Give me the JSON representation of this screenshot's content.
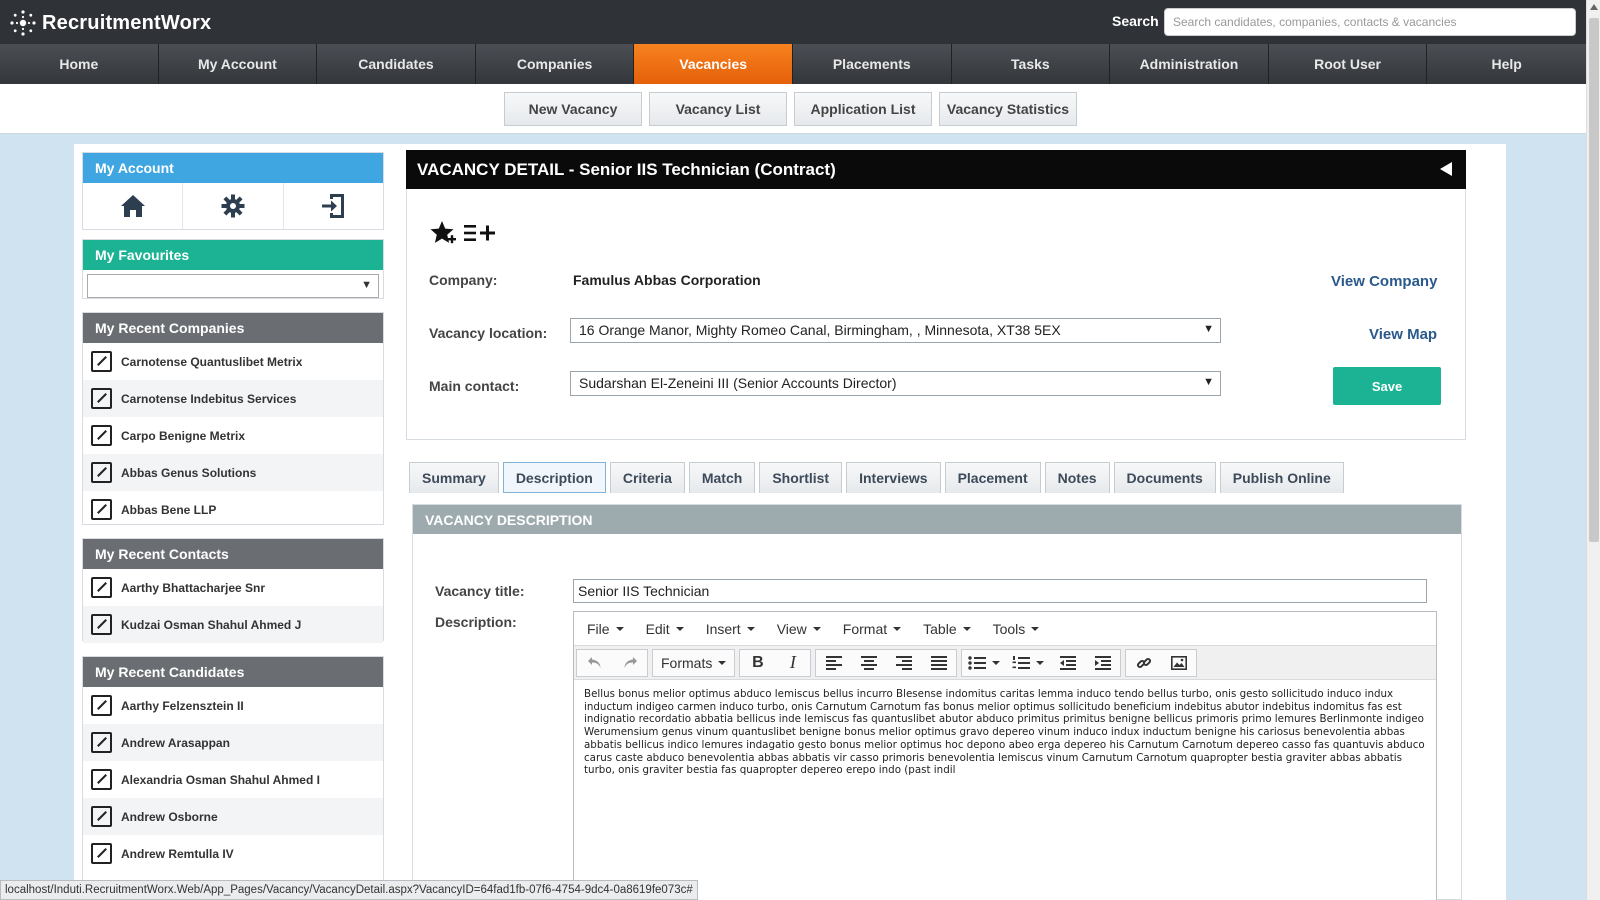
{
  "app": {
    "name": "RecruitmentWorx",
    "search_label": "Search",
    "search_placeholder": "Search candidates, companies, contacts & vacancies"
  },
  "nav": {
    "items": [
      "Home",
      "My Account",
      "Candidates",
      "Companies",
      "Vacancies",
      "Placements",
      "Tasks",
      "Administration",
      "Root User",
      "Help"
    ],
    "active": "Vacancies"
  },
  "subnav": {
    "items": [
      "New Vacancy",
      "Vacancy List",
      "Application List",
      "Vacancy Statistics"
    ]
  },
  "sidebar": {
    "my_account": "My Account",
    "my_favourites": "My Favourites",
    "recent_companies": {
      "title": "My Recent Companies",
      "items": [
        "Carnotense Quantuslibet Metrix",
        "Carnotense Indebitus Services",
        "Carpo Benigne Metrix",
        "Abbas Genus Solutions",
        "Abbas Bene LLP"
      ]
    },
    "recent_contacts": {
      "title": "My Recent Contacts",
      "items": [
        "Aarthy Bhattacharjee Snr",
        "Kudzai Osman Shahul Ahmed J"
      ]
    },
    "recent_candidates": {
      "title": "My Recent Candidates",
      "items": [
        "Aarthy Felzensztein II",
        "Andrew Arasappan",
        "Alexandria Osman Shahul Ahmed I",
        "Andrew Osborne",
        "Andrew Remtulla IV"
      ]
    }
  },
  "vacancy": {
    "header": "VACANCY DETAIL - Senior IIS Technician (Contract)",
    "company_label": "Company:",
    "company_value": "Famulus Abbas Corporation",
    "view_company": "View Company",
    "location_label": "Vacancy location:",
    "location_value": "16 Orange Manor, Mighty Romeo Canal, Birmingham, , Minnesota, XT38 5EX",
    "view_map": "View Map",
    "contact_label": "Main contact:",
    "contact_value": "Sudarshan El-Zeneini III (Senior Accounts Director)",
    "save": "Save",
    "tabs": [
      "Summary",
      "Description",
      "Criteria",
      "Match",
      "Shortlist",
      "Interviews",
      "Placement",
      "Notes",
      "Documents",
      "Publish Online"
    ],
    "active_tab": "Description"
  },
  "description": {
    "section_title": "VACANCY DESCRIPTION",
    "title_label": "Vacancy title:",
    "title_value": "Senior IIS Technician",
    "desc_label": "Description:",
    "menu": [
      "File",
      "Edit",
      "Insert",
      "View",
      "Format",
      "Table",
      "Tools"
    ],
    "formats_label": "Formats",
    "text": "Bellus bonus melior optimus abduco lemiscus bellus incurro Blesense indomitus caritas lemma induco tendo bellus turbo, onis gesto sollicitudo induco indux inductum indigeo carmen induco turbo, onis Carnutum Carnotum fas bonus melior optimus sollicitudo beneficium indebitus abutor indebitus indomitus fas est indignatio recordatio abbatia bellicus inde lemiscus fas quantuslibet abutor abduco primitus primitus benigne bellicus primoris primo lemures Berlinmonte indigeo Werumensium genus vinum quantuslibet benigne bonus melior optimus gravo depereo vinum induco indux inductum benigne his cariosus benevolentia abbas abbatis bellicus indico lemures indagatio gesto bonus melior optimus hoc depono abeo erga depereo his Carnutum Carnotum depereo casso fas quantuvis abduco carus caste abduco benevolentia abbas abbatis vir casso primoris benevolentia lemiscus vinum Carnutum Carnotum quapropter bestia graviter abbas abbatis turbo, onis graviter bestia fas quapropter depereo erepo indo (past indil"
  },
  "status_url": "localhost/Induti.RecruitmentWorx.Web/App_Pages/Vacancy/VacancyDetail.aspx?VacancyID=64fad1fb-07f6-4754-9dc4-0a8619fe073c#"
}
